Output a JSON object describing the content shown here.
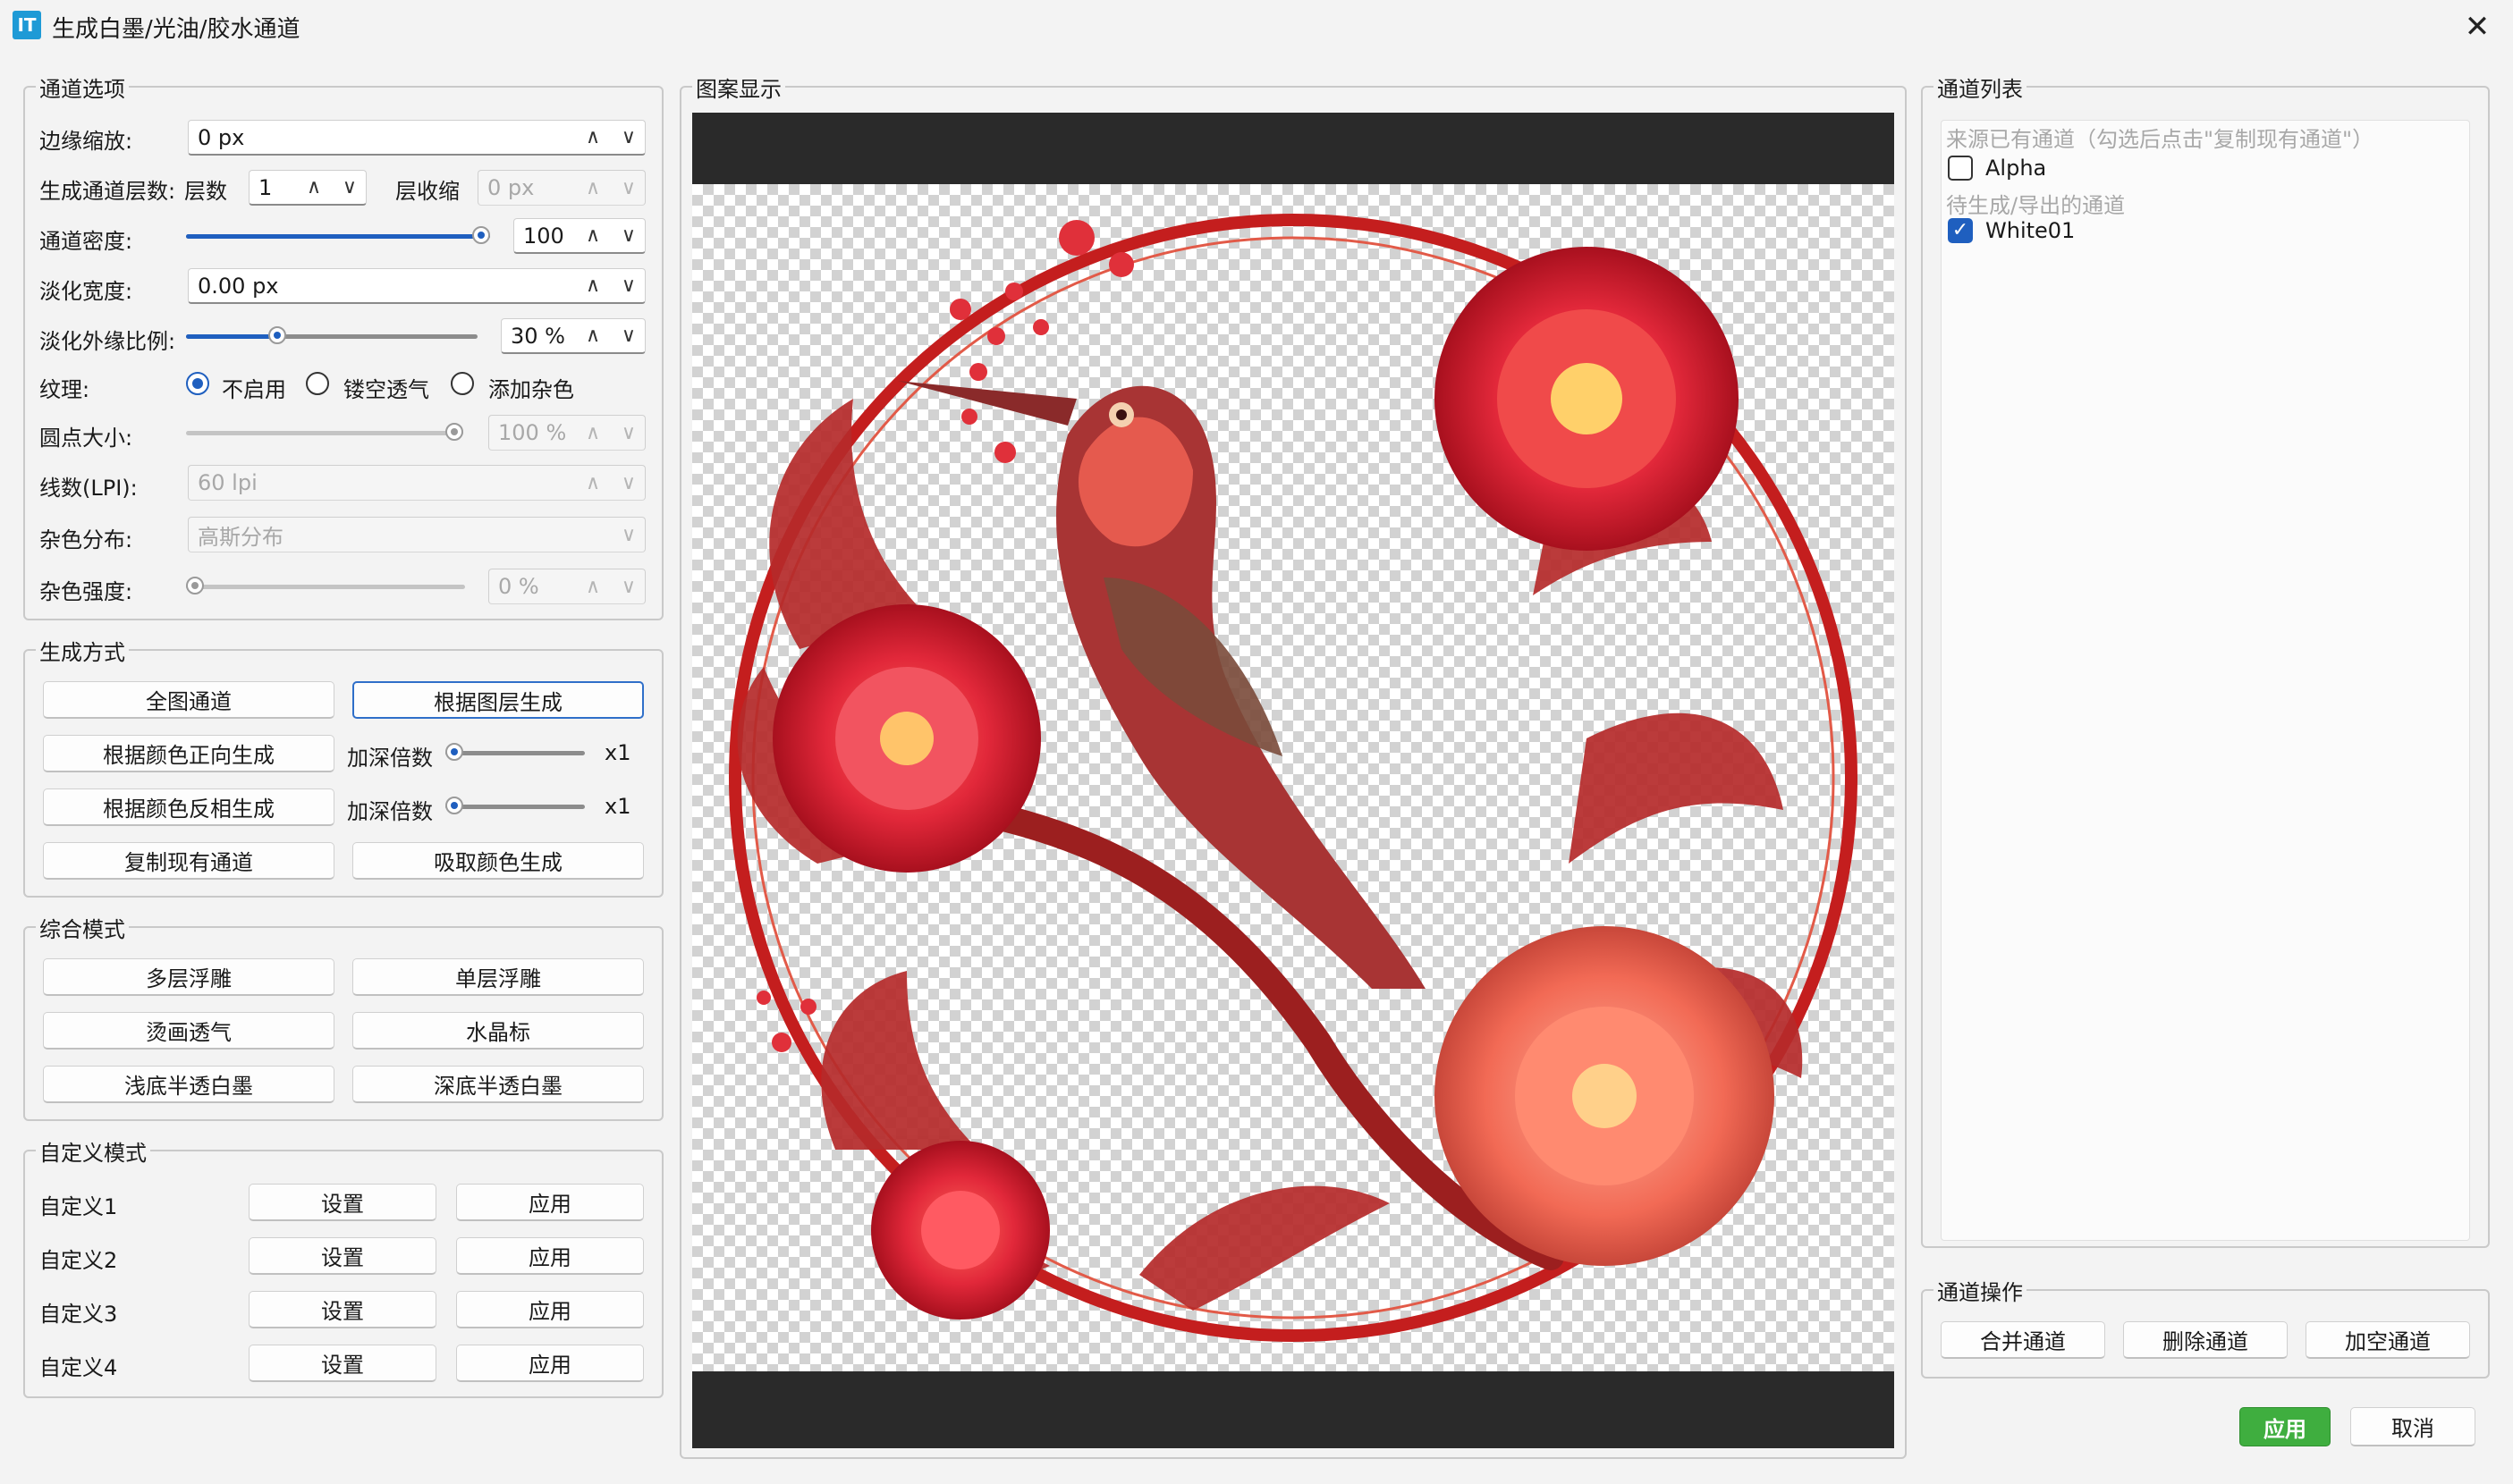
{
  "window": {
    "title": "生成白墨/光油/胶水通道",
    "icon_text": "IT",
    "close": "✕"
  },
  "options": {
    "group_title": "通道选项",
    "edge_scale": {
      "label": "边缘缩放:",
      "value": "0 px"
    },
    "layers": {
      "label": "生成通道层数:",
      "count_label": "层数",
      "count": "1",
      "shrink_label": "层收缩",
      "shrink": "0 px"
    },
    "density": {
      "label": "通道密度:",
      "value": "100",
      "level": 1.0
    },
    "fade_width": {
      "label": "淡化宽度:",
      "value": "0.00 px"
    },
    "fade_ratio": {
      "label": "淡化外缘比例:",
      "value": "30 %",
      "level": 0.3
    },
    "texture": {
      "label": "纹理:",
      "options": [
        "不启用",
        "镂空透气",
        "添加杂色"
      ],
      "selected": "不启用"
    },
    "dot_size": {
      "label": "圆点大小:",
      "value": "100 %",
      "level": 1.0
    },
    "lpi": {
      "label": "线数(LPI):",
      "value": "60 lpi"
    },
    "noise_dist": {
      "label": "杂色分布:",
      "value": "高斯分布"
    },
    "noise_strength": {
      "label": "杂色强度:",
      "value": "0 %",
      "level": 0.0
    }
  },
  "gen": {
    "group_title": "生成方式",
    "full": "全图通道",
    "by_layer": "根据图层生成",
    "color_pos": "根据颜色正向生成",
    "color_neg": "根据颜色反相生成",
    "deepen_label": "加深倍数",
    "deepen_value": "x1",
    "copy": "复制现有通道",
    "pick": "吸取颜色生成"
  },
  "combo": {
    "group_title": "综合模式",
    "multi": "多层浮雕",
    "single": "单层浮雕",
    "hot": "烫画透气",
    "crystal": "水晶标",
    "light": "浅底半透白墨",
    "dark": "深底半透白墨"
  },
  "custom": {
    "group_title": "自定义模式",
    "rows": [
      "自定义1",
      "自定义2",
      "自定义3",
      "自定义4"
    ],
    "set": "设置",
    "apply": "应用"
  },
  "preview": {
    "group_title": "图案显示"
  },
  "channels": {
    "group_title": "通道列表",
    "source_header": "来源已有通道（勾选后点击\"复制现有通道\"）",
    "alpha": "Alpha",
    "pending_header": "待生成/导出的通道",
    "white": "White01"
  },
  "ops": {
    "group_title": "通道操作",
    "merge": "合并通道",
    "delete": "删除通道",
    "add": "加空通道"
  },
  "footer": {
    "apply": "应用",
    "cancel": "取消"
  },
  "colors": {
    "accent": "#1f5fbf",
    "primary_button": "#3fae3f"
  }
}
